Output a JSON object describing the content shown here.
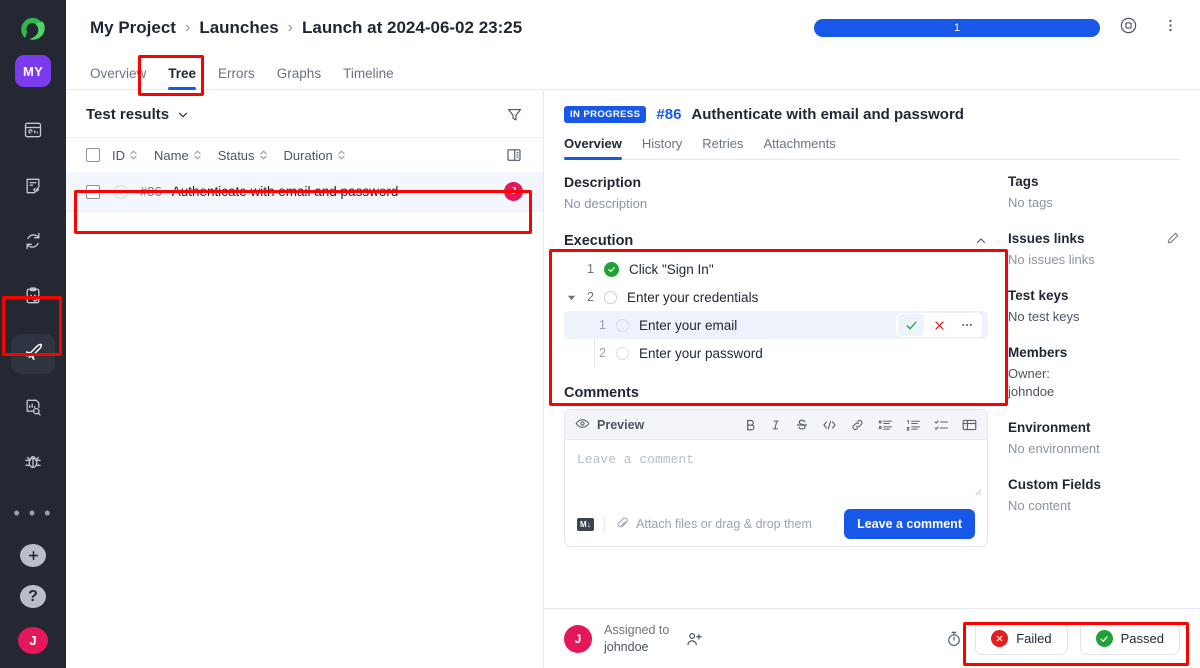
{
  "rail": {
    "logo_label": "a",
    "workspace_badge": "MY",
    "items": [
      {
        "name": "dashboards-icon",
        "label": "Dashboards"
      },
      {
        "name": "test-cases-icon",
        "label": "Test cases"
      },
      {
        "name": "sync-icon",
        "label": "Jobs"
      },
      {
        "name": "test-plan-icon",
        "label": "Test plans"
      },
      {
        "name": "launches-icon",
        "label": "Launches",
        "active": true
      },
      {
        "name": "analytics-icon",
        "label": "Analytics"
      },
      {
        "name": "defects-icon",
        "label": "Defects"
      },
      {
        "name": "more-icon",
        "label": "More"
      }
    ],
    "add_label": "+",
    "help_label": "?",
    "avatar_label": "J"
  },
  "topbar": {
    "breadcrumb": [
      "My Project",
      "Launches",
      "Launch at 2024-06-02 23:25"
    ],
    "separator": "›",
    "progress": {
      "value": 1,
      "label": "1",
      "percent": 100,
      "color": "#1758e8"
    },
    "stop_icon": "stop-circle-icon",
    "menu_icon": "more-vertical-icon"
  },
  "tabs": [
    {
      "label": "Overview",
      "active": false
    },
    {
      "label": "Tree",
      "active": true
    },
    {
      "label": "Errors",
      "active": false
    },
    {
      "label": "Graphs",
      "active": false
    },
    {
      "label": "Timeline",
      "active": false
    }
  ],
  "left_panel": {
    "title": "Test results",
    "filter_icon": "filter-icon",
    "columns_icon": "columns-icon",
    "columns": [
      "ID",
      "Name",
      "Status",
      "Duration"
    ],
    "rows": [
      {
        "id": "#86",
        "name": "Authenticate with email and password",
        "avatar": "J",
        "selected": true
      }
    ]
  },
  "detail": {
    "status_badge": "IN PROGRESS",
    "id": "#86",
    "name": "Authenticate with email and password",
    "tabs": [
      {
        "label": "Overview",
        "active": true
      },
      {
        "label": "History",
        "active": false
      },
      {
        "label": "Retries",
        "active": false
      },
      {
        "label": "Attachments",
        "active": false
      }
    ],
    "description": {
      "heading": "Description",
      "value": "No description"
    },
    "execution": {
      "heading": "Execution",
      "collapse_icon": "chevron-up-icon",
      "steps": [
        {
          "num": "1",
          "label": "Click \"Sign In\"",
          "status": "passed",
          "level": 0
        },
        {
          "num": "2",
          "label": "Enter your credentials",
          "status": "pending",
          "level": 0,
          "expanded": true
        },
        {
          "num": "1",
          "label": "Enter your email",
          "status": "pending",
          "level": 1,
          "hovered": true,
          "actions": [
            {
              "name": "mark-passed-icon",
              "label": "Pass"
            },
            {
              "name": "mark-failed-icon",
              "label": "Fail"
            },
            {
              "name": "step-more-icon",
              "label": "More"
            }
          ]
        },
        {
          "num": "2",
          "label": "Enter your password",
          "status": "pending",
          "level": 1
        }
      ]
    },
    "comments": {
      "heading": "Comments",
      "preview_label": "Preview",
      "preview_icon": "eye-icon",
      "tools": [
        {
          "name": "bold-icon",
          "glyph": "B"
        },
        {
          "name": "italic-icon",
          "glyph": "I"
        },
        {
          "name": "strikethrough-icon",
          "glyph": "S"
        },
        {
          "name": "code-icon",
          "glyph": "</>"
        },
        {
          "name": "link-icon",
          "glyph": "link"
        },
        {
          "name": "bullet-list-icon",
          "glyph": "ul"
        },
        {
          "name": "numbered-list-icon",
          "glyph": "ol"
        },
        {
          "name": "task-list-icon",
          "glyph": "task"
        },
        {
          "name": "table-icon",
          "glyph": "table"
        }
      ],
      "placeholder": "Leave a comment",
      "markdown_badge": "M↓",
      "attach_label": "Attach files or drag & drop them",
      "submit_label": "Leave a comment"
    },
    "sidebar": [
      {
        "heading": "Tags",
        "value": "No tags"
      },
      {
        "heading": "Issues links",
        "value": "No issues links",
        "edit_icon": "pencil-icon"
      },
      {
        "heading": "Test keys",
        "value": "No test keys"
      },
      {
        "heading": "Members",
        "value": "Owner:\njohndoe",
        "dark": true
      },
      {
        "heading": "Environment",
        "value": "No environment"
      },
      {
        "heading": "Custom Fields",
        "value": "No content"
      }
    ]
  },
  "bottombar": {
    "avatar": "J",
    "assigned_label": "Assigned to",
    "assignee": "johndoe",
    "add_user_icon": "add-user-icon",
    "timer_icon": "stopwatch-icon",
    "failed_label": "Failed",
    "passed_label": "Passed",
    "failed_color": "#e02020",
    "passed_color": "#21a136"
  }
}
